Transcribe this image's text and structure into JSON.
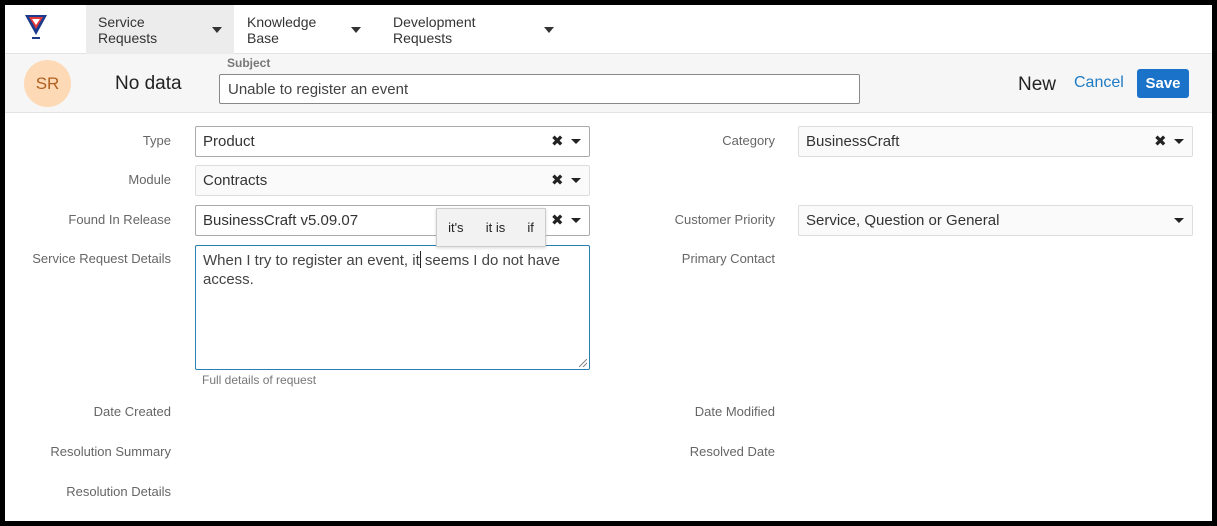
{
  "nav": {
    "tabs": [
      {
        "label": "Service Requests"
      },
      {
        "label": "Knowledge Base"
      },
      {
        "label": "Development Requests"
      }
    ]
  },
  "header": {
    "avatar": "SR",
    "title": "No data",
    "subject_label": "Subject",
    "subject_value": "Unable to register an event",
    "status": "New",
    "cancel_label": "Cancel",
    "save_label": "Save"
  },
  "form": {
    "type": {
      "label": "Type",
      "value": "Product"
    },
    "module": {
      "label": "Module",
      "value": "Contracts"
    },
    "found_in_release": {
      "label": "Found In Release",
      "value": "BusinessCraft v5.09.07"
    },
    "details": {
      "label": "Service Request Details",
      "text_before": "When I try to register an event, it",
      "text_after": " seems I do not have access.",
      "hint": "Full details of request"
    },
    "date_created": {
      "label": "Date Created"
    },
    "resolution_summary": {
      "label": "Resolution Summary"
    },
    "resolution_details": {
      "label": "Resolution Details"
    },
    "category": {
      "label": "Category",
      "value": "BusinessCraft"
    },
    "customer_priority": {
      "label": "Customer Priority",
      "value": "Service, Question or General"
    },
    "primary_contact": {
      "label": "Primary Contact"
    },
    "date_modified": {
      "label": "Date Modified"
    },
    "resolved_date": {
      "label": "Resolved Date"
    }
  },
  "suggestions": [
    "it's",
    "it is",
    "if"
  ],
  "colors": {
    "accent": "#1a73c9",
    "link": "#1e7bc4",
    "avatar_bg": "#fdd9b5"
  }
}
